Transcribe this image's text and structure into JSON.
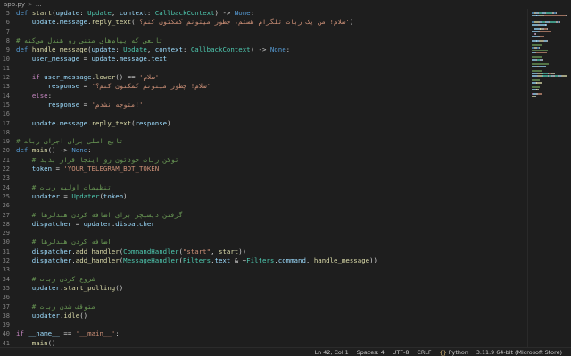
{
  "breadcrumb": {
    "file": "app.py",
    "separator": ">",
    "more": "..."
  },
  "gutter": [
    "5",
    "6",
    "7",
    "8",
    "9",
    "10",
    "11",
    "12",
    "13",
    "14",
    "15",
    "16",
    "17",
    "18",
    "19",
    "20",
    "21",
    "22",
    "23",
    "24",
    "25",
    "26",
    "27",
    "28",
    "29",
    "30",
    "31",
    "32",
    "33",
    "34",
    "35",
    "36",
    "37",
    "38",
    "39",
    "40",
    "41",
    "42"
  ],
  "code": [
    [
      {
        "t": "def ",
        "c": "kw"
      },
      {
        "t": "start",
        "c": "fn"
      },
      {
        "t": "(",
        "c": "pun"
      },
      {
        "t": "update",
        "c": "var"
      },
      {
        "t": ": ",
        "c": "pun"
      },
      {
        "t": "Update",
        "c": "cls"
      },
      {
        "t": ", ",
        "c": "pun"
      },
      {
        "t": "context",
        "c": "var"
      },
      {
        "t": ": ",
        "c": "pun"
      },
      {
        "t": "CallbackContext",
        "c": "cls"
      },
      {
        "t": ") -> ",
        "c": "pun"
      },
      {
        "t": "None",
        "c": "kw"
      },
      {
        "t": ":",
        "c": "pun"
      }
    ],
    [
      {
        "t": "    update",
        "c": "var"
      },
      {
        "t": ".",
        "c": "pun"
      },
      {
        "t": "message",
        "c": "var"
      },
      {
        "t": ".",
        "c": "pun"
      },
      {
        "t": "reply_text",
        "c": "fn"
      },
      {
        "t": "(",
        "c": "pun"
      },
      {
        "t": "'سلام! من یک ربات تلگرام هستم، چطور میتونم کمکتون کنم؟'",
        "c": "str"
      },
      {
        "t": ")",
        "c": "pun"
      }
    ],
    [],
    [
      {
        "t": "# تابعی که پیام‌های متنی رو هندل می‌کنه",
        "c": "cmt"
      }
    ],
    [
      {
        "t": "def ",
        "c": "kw"
      },
      {
        "t": "handle_message",
        "c": "fn"
      },
      {
        "t": "(",
        "c": "pun"
      },
      {
        "t": "update",
        "c": "var"
      },
      {
        "t": ": ",
        "c": "pun"
      },
      {
        "t": "Update",
        "c": "cls"
      },
      {
        "t": ", ",
        "c": "pun"
      },
      {
        "t": "context",
        "c": "var"
      },
      {
        "t": ": ",
        "c": "pun"
      },
      {
        "t": "CallbackContext",
        "c": "cls"
      },
      {
        "t": ") -> ",
        "c": "pun"
      },
      {
        "t": "None",
        "c": "kw"
      },
      {
        "t": ":",
        "c": "pun"
      }
    ],
    [
      {
        "t": "    user_message",
        "c": "var"
      },
      {
        "t": " = ",
        "c": "pun"
      },
      {
        "t": "update",
        "c": "var"
      },
      {
        "t": ".",
        "c": "pun"
      },
      {
        "t": "message",
        "c": "var"
      },
      {
        "t": ".",
        "c": "pun"
      },
      {
        "t": "text",
        "c": "var"
      }
    ],
    [],
    [
      {
        "t": "    ",
        "c": "pun"
      },
      {
        "t": "if ",
        "c": "ctl"
      },
      {
        "t": "user_message",
        "c": "var"
      },
      {
        "t": ".",
        "c": "pun"
      },
      {
        "t": "lower",
        "c": "fn"
      },
      {
        "t": "() == ",
        "c": "pun"
      },
      {
        "t": "'سلام'",
        "c": "str"
      },
      {
        "t": ":",
        "c": "pun"
      }
    ],
    [
      {
        "t": "        response",
        "c": "var"
      },
      {
        "t": " = ",
        "c": "pun"
      },
      {
        "t": "'سلام! چطور میتونم کمکتون کنم؟'",
        "c": "str"
      }
    ],
    [
      {
        "t": "    ",
        "c": "pun"
      },
      {
        "t": "else",
        "c": "ctl"
      },
      {
        "t": ":",
        "c": "pun"
      }
    ],
    [
      {
        "t": "        response",
        "c": "var"
      },
      {
        "t": " = ",
        "c": "pun"
      },
      {
        "t": "'متوجه نشدم!'",
        "c": "str"
      }
    ],
    [],
    [
      {
        "t": "    update",
        "c": "var"
      },
      {
        "t": ".",
        "c": "pun"
      },
      {
        "t": "message",
        "c": "var"
      },
      {
        "t": ".",
        "c": "pun"
      },
      {
        "t": "reply_text",
        "c": "fn"
      },
      {
        "t": "(",
        "c": "pun"
      },
      {
        "t": "response",
        "c": "var"
      },
      {
        "t": ")",
        "c": "pun"
      }
    ],
    [],
    [
      {
        "t": "# تابع اصلی برای اجرای ربات",
        "c": "cmt"
      }
    ],
    [
      {
        "t": "def ",
        "c": "kw"
      },
      {
        "t": "main",
        "c": "fn"
      },
      {
        "t": "() -> ",
        "c": "pun"
      },
      {
        "t": "None",
        "c": "kw"
      },
      {
        "t": ":",
        "c": "pun"
      }
    ],
    [
      {
        "t": "    # توکن ربات خودتون رو اینجا قرار بدید",
        "c": "cmt"
      }
    ],
    [
      {
        "t": "    token",
        "c": "var"
      },
      {
        "t": " = ",
        "c": "pun"
      },
      {
        "t": "'YOUR_TELEGRAM_BOT_TOKEN'",
        "c": "str"
      }
    ],
    [],
    [
      {
        "t": "    # تنظیمات اولیه ربات",
        "c": "cmt"
      }
    ],
    [
      {
        "t": "    updater",
        "c": "var"
      },
      {
        "t": " = ",
        "c": "pun"
      },
      {
        "t": "Updater",
        "c": "cls"
      },
      {
        "t": "(",
        "c": "pun"
      },
      {
        "t": "token",
        "c": "var"
      },
      {
        "t": ")",
        "c": "pun"
      }
    ],
    [],
    [
      {
        "t": "    # گرفتن دیسپچر برای اضافه کردن هندلرها",
        "c": "cmt"
      }
    ],
    [
      {
        "t": "    dispatcher",
        "c": "var"
      },
      {
        "t": " = ",
        "c": "pun"
      },
      {
        "t": "updater",
        "c": "var"
      },
      {
        "t": ".",
        "c": "pun"
      },
      {
        "t": "dispatcher",
        "c": "var"
      }
    ],
    [],
    [
      {
        "t": "    # اضافه کردن هندلرها",
        "c": "cmt"
      }
    ],
    [
      {
        "t": "    dispatcher",
        "c": "var"
      },
      {
        "t": ".",
        "c": "pun"
      },
      {
        "t": "add_handler",
        "c": "fn"
      },
      {
        "t": "(",
        "c": "pun"
      },
      {
        "t": "CommandHandler",
        "c": "cls"
      },
      {
        "t": "(",
        "c": "pun"
      },
      {
        "t": "\"start\"",
        "c": "str"
      },
      {
        "t": ", ",
        "c": "pun"
      },
      {
        "t": "start",
        "c": "fn"
      },
      {
        "t": "))",
        "c": "pun"
      }
    ],
    [
      {
        "t": "    dispatcher",
        "c": "var"
      },
      {
        "t": ".",
        "c": "pun"
      },
      {
        "t": "add_handler",
        "c": "fn"
      },
      {
        "t": "(",
        "c": "pun"
      },
      {
        "t": "MessageHandler",
        "c": "cls"
      },
      {
        "t": "(",
        "c": "pun"
      },
      {
        "t": "Filters",
        "c": "cls"
      },
      {
        "t": ".",
        "c": "pun"
      },
      {
        "t": "text",
        "c": "var"
      },
      {
        "t": " & ~",
        "c": "pun"
      },
      {
        "t": "Filters",
        "c": "cls"
      },
      {
        "t": ".",
        "c": "pun"
      },
      {
        "t": "command",
        "c": "var"
      },
      {
        "t": ", ",
        "c": "pun"
      },
      {
        "t": "handle_message",
        "c": "fn"
      },
      {
        "t": "))",
        "c": "pun"
      }
    ],
    [],
    [
      {
        "t": "    # شروع کردن ربات",
        "c": "cmt"
      }
    ],
    [
      {
        "t": "    updater",
        "c": "var"
      },
      {
        "t": ".",
        "c": "pun"
      },
      {
        "t": "start_polling",
        "c": "fn"
      },
      {
        "t": "()",
        "c": "pun"
      }
    ],
    [],
    [
      {
        "t": "    # متوقف شدن ربات",
        "c": "cmt"
      }
    ],
    [
      {
        "t": "    updater",
        "c": "var"
      },
      {
        "t": ".",
        "c": "pun"
      },
      {
        "t": "idle",
        "c": "fn"
      },
      {
        "t": "()",
        "c": "pun"
      }
    ],
    [],
    [
      {
        "t": "if ",
        "c": "ctl"
      },
      {
        "t": "__name__",
        "c": "var"
      },
      {
        "t": " == ",
        "c": "pun"
      },
      {
        "t": "'__main__'",
        "c": "str"
      },
      {
        "t": ":",
        "c": "pun"
      }
    ],
    [
      {
        "t": "    main",
        "c": "fn"
      },
      {
        "t": "()",
        "c": "pun"
      }
    ]
  ],
  "status": {
    "position": "Ln 42, Col 1",
    "spaces": "Spaces: 4",
    "encoding": "UTF-8",
    "eol": "CRLF",
    "language": "Python",
    "interpreter": "3.11.9 64-bit (Microsoft Store)"
  },
  "colors": {
    "background": "#1e1e1e",
    "keyword": "#569cd6",
    "control": "#c586c0",
    "function": "#dcdcaa",
    "class": "#4ec9b0",
    "variable": "#9cdcfe",
    "string": "#ce9178",
    "comment": "#6a9955"
  },
  "icons": {
    "language": "python-icon"
  }
}
